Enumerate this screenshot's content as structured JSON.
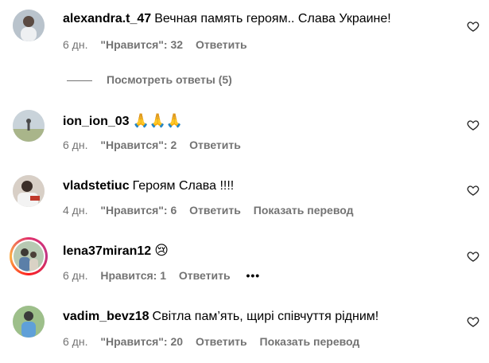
{
  "comments": [
    {
      "username": "alexandra.t_47",
      "text": "Вечная память героям.. Слава Украине!",
      "time": "6 дн.",
      "likes": "\"Нравится\": 32",
      "reply": "Ответить",
      "translate": ""
    },
    {
      "username": "ion_ion_03",
      "text": "🙏🙏🙏",
      "time": "6 дн.",
      "likes": "\"Нравится\": 2",
      "reply": "Ответить",
      "translate": ""
    },
    {
      "username": "vladstetiuc",
      "text": "Героям Слава !!!!",
      "time": "4 дн.",
      "likes": "\"Нравится\": 6",
      "reply": "Ответить",
      "translate": "Показать перевод"
    },
    {
      "username": "lena37miran12",
      "text": "😢",
      "time": "6 дн.",
      "likes": "Нравится: 1",
      "reply": "Ответить",
      "translate": ""
    },
    {
      "username": "vadim_bevz18",
      "text": "Світла пам’ять, щирі співчуття рідним!",
      "time": "6 дн.",
      "likes": "\"Нравится\": 20",
      "reply": "Ответить",
      "translate": "Показать перевод"
    }
  ],
  "view_replies": "Посмотреть ответы (5)",
  "more_options": "•••",
  "icons": {
    "like": "heart-icon",
    "more": "more-options-icon"
  }
}
